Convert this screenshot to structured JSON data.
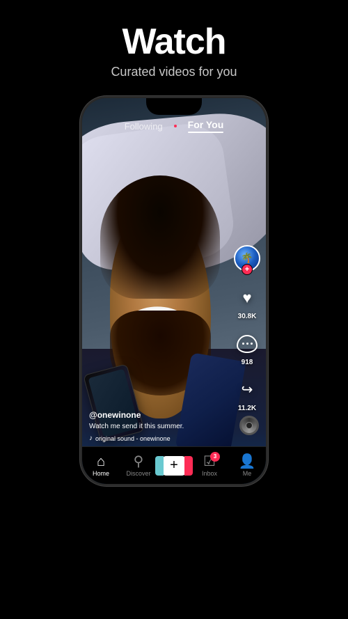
{
  "hero": {
    "title": "Watch",
    "subtitle": "Curated videos for you"
  },
  "phone": {
    "top_nav": {
      "following": "Following",
      "for_you": "For You"
    },
    "video": {
      "username": "@onewinone",
      "caption": "Watch me send it this summer.",
      "sound": "original sound - onewinone"
    },
    "sidebar": {
      "likes": "30.8K",
      "comments": "918",
      "shares": "11.2K"
    },
    "bottom_nav": {
      "home": "Home",
      "discover": "Discover",
      "inbox": "Inbox",
      "inbox_badge": "3",
      "me": "Me"
    }
  }
}
